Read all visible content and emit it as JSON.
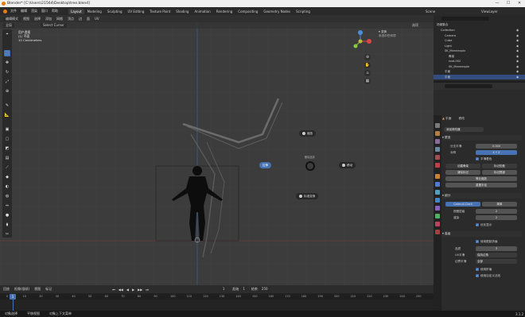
{
  "window": {
    "title": "Blender* [C:\\Users\\21564\\Desktop\\tree.blend]",
    "minimize": "—",
    "maximize": "☐",
    "close": "✕"
  },
  "menu": [
    "文件",
    "编辑",
    "渲染",
    "窗口",
    "帮助"
  ],
  "workspaces": [
    "Layout",
    "Modeling",
    "Sculpting",
    "UV Editing",
    "Texture Paint",
    "Shading",
    "Animation",
    "Rendering",
    "Compositing",
    "Geometry Nodes",
    "Scripting"
  ],
  "active_workspace": "Layout",
  "scene": {
    "label": "Scene",
    "view_layer": "ViewLayer"
  },
  "viewport": {
    "mode": "编辑模式",
    "menus": [
      "视图",
      "选择",
      "添加",
      "网格",
      "顶点",
      "边",
      "面",
      "UV"
    ],
    "transform_orientation": "全局",
    "snap": "Select Cursor",
    "overlay_lines": [
      "用户透视",
      "(1) 平面",
      "10 Centimeters"
    ],
    "options_label": "选项",
    "sidebar_hint": "未选中任何项",
    "pie": {
      "center_label": "旋转",
      "left": "拉伸",
      "top": "缩放",
      "right": "移动",
      "bottom_right": "标准变换",
      "center_small": "删除选择"
    }
  },
  "gizmo": {
    "x": "X",
    "y": "Y",
    "z": "Z"
  },
  "timeline": {
    "menus": [
      "回放",
      "抠像(插帧)",
      "视图",
      "标记"
    ],
    "current_frame": "1",
    "start_label": "起始",
    "start": "1",
    "end_label": "结束",
    "end": "250",
    "ticks": [
      "0",
      "10",
      "20",
      "30",
      "40",
      "50",
      "60",
      "70",
      "80",
      "90",
      "100",
      "110",
      "120",
      "130",
      "140",
      "150",
      "160",
      "170",
      "180",
      "190",
      "200",
      "210",
      "220",
      "230",
      "240",
      "250"
    ]
  },
  "status": {
    "left": "对象选择",
    "middle": "平移视图",
    "right": "对象上下文菜单",
    "version": "3.1.2"
  },
  "outliner": {
    "search_placeholder": "",
    "header": "场景集合",
    "items": [
      {
        "label": "Collection",
        "indent": 1
      },
      {
        "label": "Camera",
        "indent": 2
      },
      {
        "label": "Cube",
        "indent": 2
      },
      {
        "label": "Light",
        "indent": 2
      },
      {
        "label": "SK_Mannequin",
        "indent": 2
      },
      {
        "label": "骨架",
        "indent": 3
      },
      {
        "label": "root.002",
        "indent": 3
      },
      {
        "label": "SK_Mannequin",
        "indent": 3
      },
      {
        "label": "平面",
        "indent": 2
      },
      {
        "label": "平面",
        "indent": 2
      }
    ],
    "selected_index": 9
  },
  "properties": {
    "object_name": "平面",
    "modifier_name": "修改",
    "add_modifier": "添加修改器",
    "mod1": {
      "name": "蒙皮",
      "rows": [
        {
          "label": "分支平滑",
          "value": "0.000"
        },
        {
          "label": "对称",
          "value": "X  Y  Z"
        }
      ],
      "smooth_shading": "平滑着色",
      "buttons": [
        "创建骨架",
        "标记松散",
        "清除标记",
        "标记根部",
        "等比缩放",
        "重置半径"
      ]
    },
    "mod2": {
      "name": "细分",
      "tabs": [
        "Catmull-Clark",
        "简单"
      ],
      "rows": [
        {
          "label": "视图层级",
          "value": "2"
        },
        {
          "label": "渲染",
          "value": "2"
        }
      ],
      "optimal_display": "优化显示"
    },
    "advanced": {
      "title": "高级",
      "rows": [
        "使用限制折痕",
        "品质",
        "UV平滑",
        "边界平滑",
        "使用折痕",
        "使用自定义法线"
      ],
      "values": [
        "",
        "3",
        "保持边角",
        "全部",
        "",
        ""
      ]
    }
  }
}
